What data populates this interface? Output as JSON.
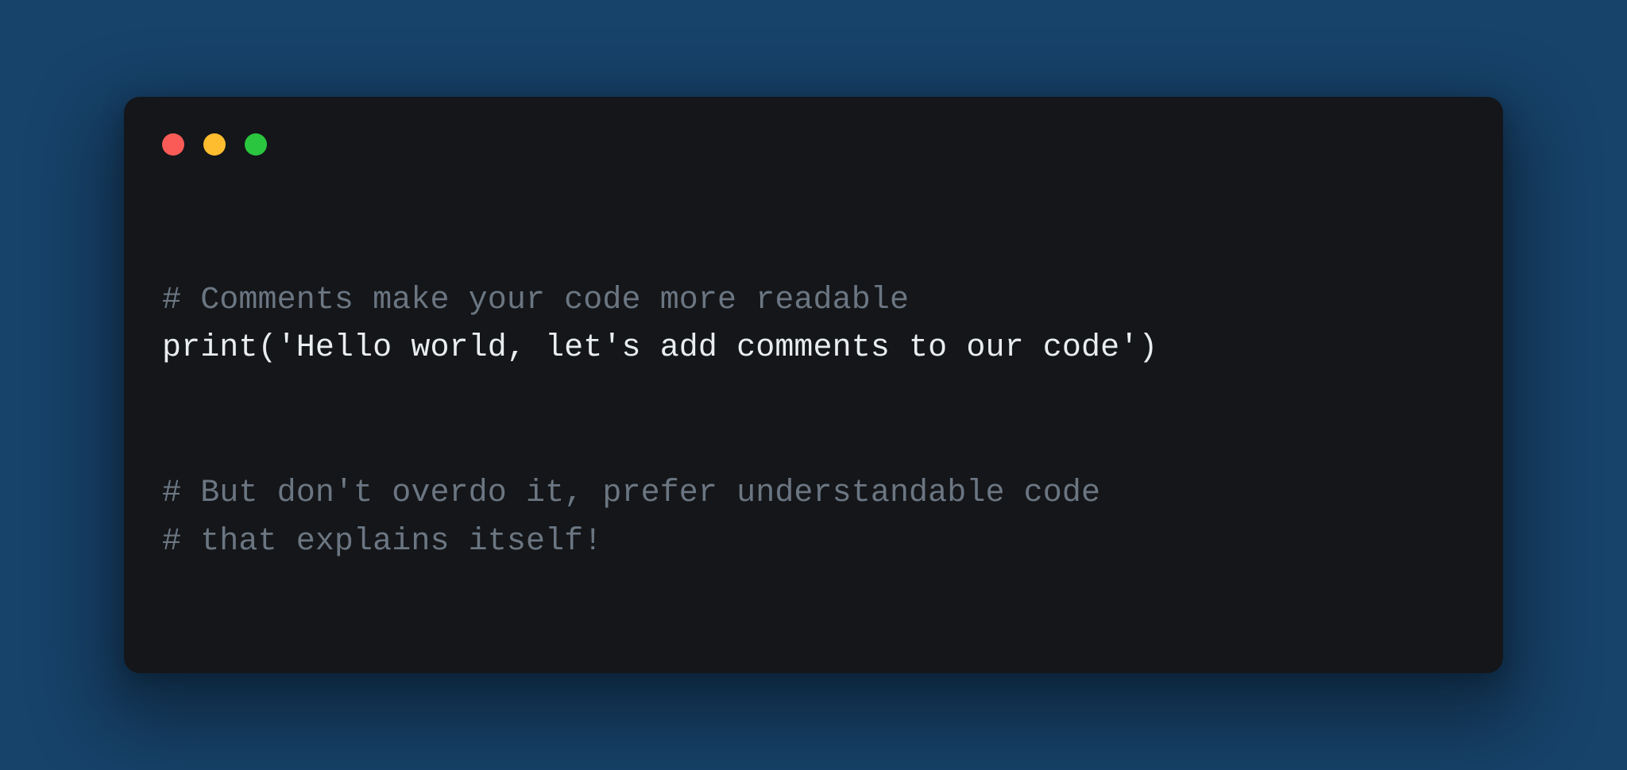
{
  "colors": {
    "close": "#fb5b57",
    "minimize": "#febd2f",
    "zoom": "#2ac63f"
  },
  "code": {
    "line1_comment": "# Comments make your code more readable",
    "line2_code": "print('Hello world, let's add comments to our code')",
    "line4_comment": "# But don't overdo it, prefer understandable code",
    "line5_comment": "# that explains itself!"
  }
}
